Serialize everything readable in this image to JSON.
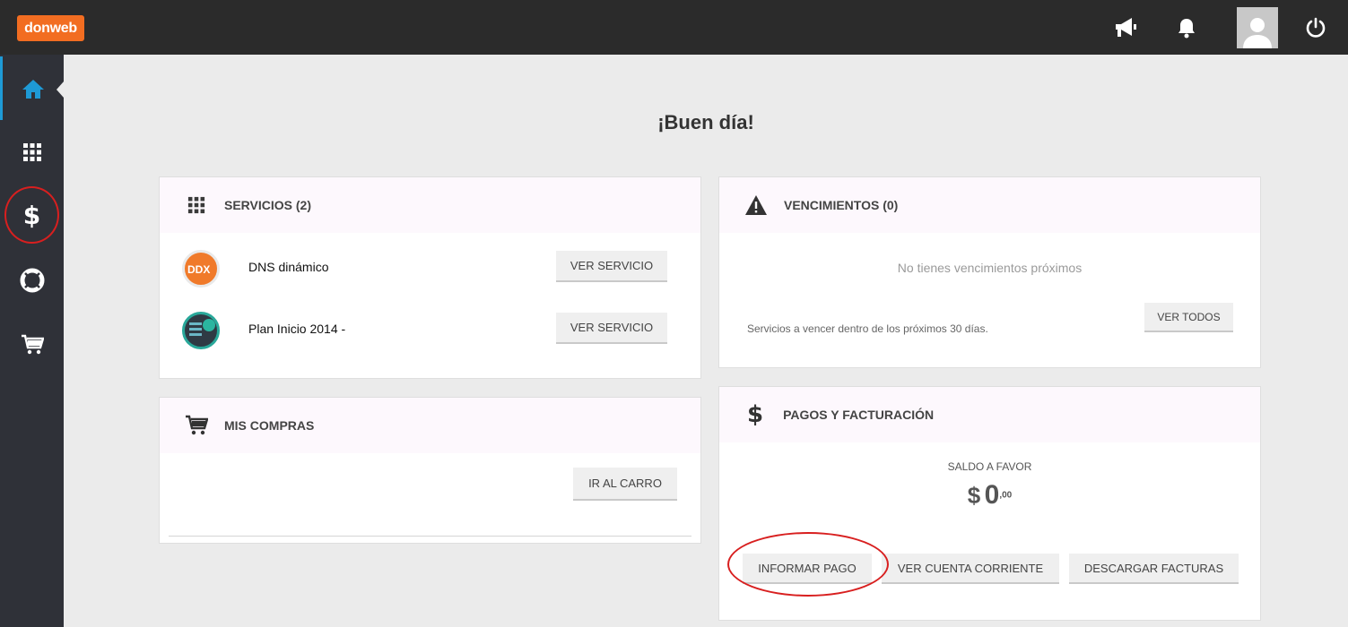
{
  "brand": {
    "logo_text": "donweb"
  },
  "greeting": "¡Buen día!",
  "services": {
    "title": "SERVICIOS (2)",
    "items": [
      {
        "name": "DNS dinámico",
        "button": "VER SERVICIO"
      },
      {
        "name": "Plan Inicio 2014 -",
        "button": "VER SERVICIO"
      }
    ]
  },
  "purchases": {
    "title": "MIS COMPRAS",
    "button": "IR AL CARRO"
  },
  "expirations": {
    "title": "VENCIMIENTOS (0)",
    "empty_text": "No tienes vencimientos próximos",
    "note": "Servicios a vencer dentro de los próximos 30 días.",
    "button": "VER TODOS"
  },
  "payments": {
    "title": "PAGOS Y FACTURACIÓN",
    "balance_label": "SALDO A FAVOR",
    "currency": "$",
    "amount": "0",
    "cents": ",00",
    "buttons": {
      "inform": "INFORMAR PAGO",
      "account": "VER CUENTA CORRIENTE",
      "invoices": "DESCARGAR FACTURAS"
    }
  },
  "colors": {
    "brand": "#f26d21",
    "accent": "#1e9ad6",
    "annotation": "#d81f1f"
  },
  "icons": [
    "megaphone-icon",
    "bell-icon",
    "user-icon",
    "power-icon",
    "home-icon",
    "grid-icon",
    "dollar-icon",
    "lifebuoy-icon",
    "cart-icon",
    "warning-icon"
  ]
}
